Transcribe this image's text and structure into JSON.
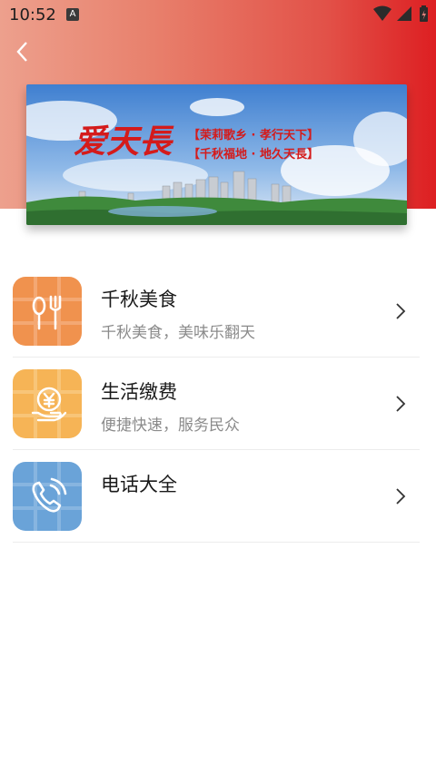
{
  "status_bar": {
    "time": "10:52",
    "indicator": "A",
    "icons": [
      "wifi-icon",
      "signal-icon",
      "battery-charging-icon"
    ]
  },
  "header": {
    "back_icon": "chevron-left-icon",
    "gradient": [
      "#eda08d",
      "#dd1f22"
    ]
  },
  "banner": {
    "title": "爱天長",
    "slogan_line1": "【茉莉歌乡 · 孝行天下】",
    "slogan_line2": "【千秋福地 · 地久天長】"
  },
  "services": [
    {
      "title": "千秋美食",
      "subtitle": "千秋美食，美味乐翻天",
      "icon": "fork-spoon-icon",
      "color": "#f0924e"
    },
    {
      "title": "生活缴费",
      "subtitle": "便捷快速，服务民众",
      "icon": "payment-hand-icon",
      "color": "#f6b456"
    },
    {
      "title": "电话大全",
      "subtitle": "",
      "icon": "phone-icon",
      "color": "#6aa3d8"
    }
  ]
}
